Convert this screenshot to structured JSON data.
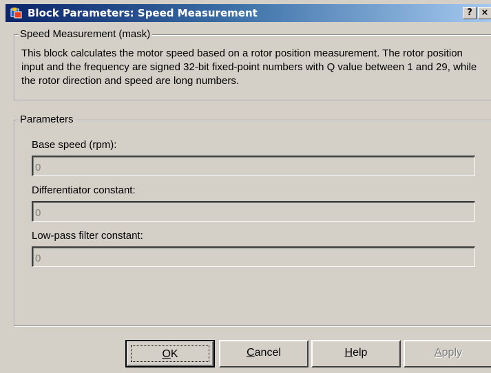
{
  "window": {
    "title": "Block Parameters: Speed Measurement",
    "icon": "simulink-block-icon",
    "help_caption": "?",
    "close_caption": "×"
  },
  "description": {
    "group_title": "Speed Measurement (mask)",
    "text": "This block calculates the motor speed based on a rotor position measurement. The rotor position input and the frequency are signed 32-bit fixed-point numbers with Q value between 1 and 29, while the rotor direction and speed are long numbers."
  },
  "parameters": {
    "group_title": "Parameters",
    "fields": [
      {
        "label": "Base speed (rpm):",
        "value": "0"
      },
      {
        "label": "Differentiator constant:",
        "value": "0"
      },
      {
        "label": "Low-pass filter constant:",
        "value": "0"
      }
    ]
  },
  "buttons": {
    "ok": {
      "mnemonic": "O",
      "rest": "K"
    },
    "cancel": {
      "mnemonic": "C",
      "rest": "ancel"
    },
    "help": {
      "mnemonic": "H",
      "rest": "elp"
    },
    "apply": {
      "mnemonic": "A",
      "rest": "pply"
    }
  },
  "colors": {
    "titlebar_start": "#0a246a",
    "titlebar_end": "#a6caf0",
    "face": "#d4d0c8",
    "disabled_text": "#808080"
  }
}
